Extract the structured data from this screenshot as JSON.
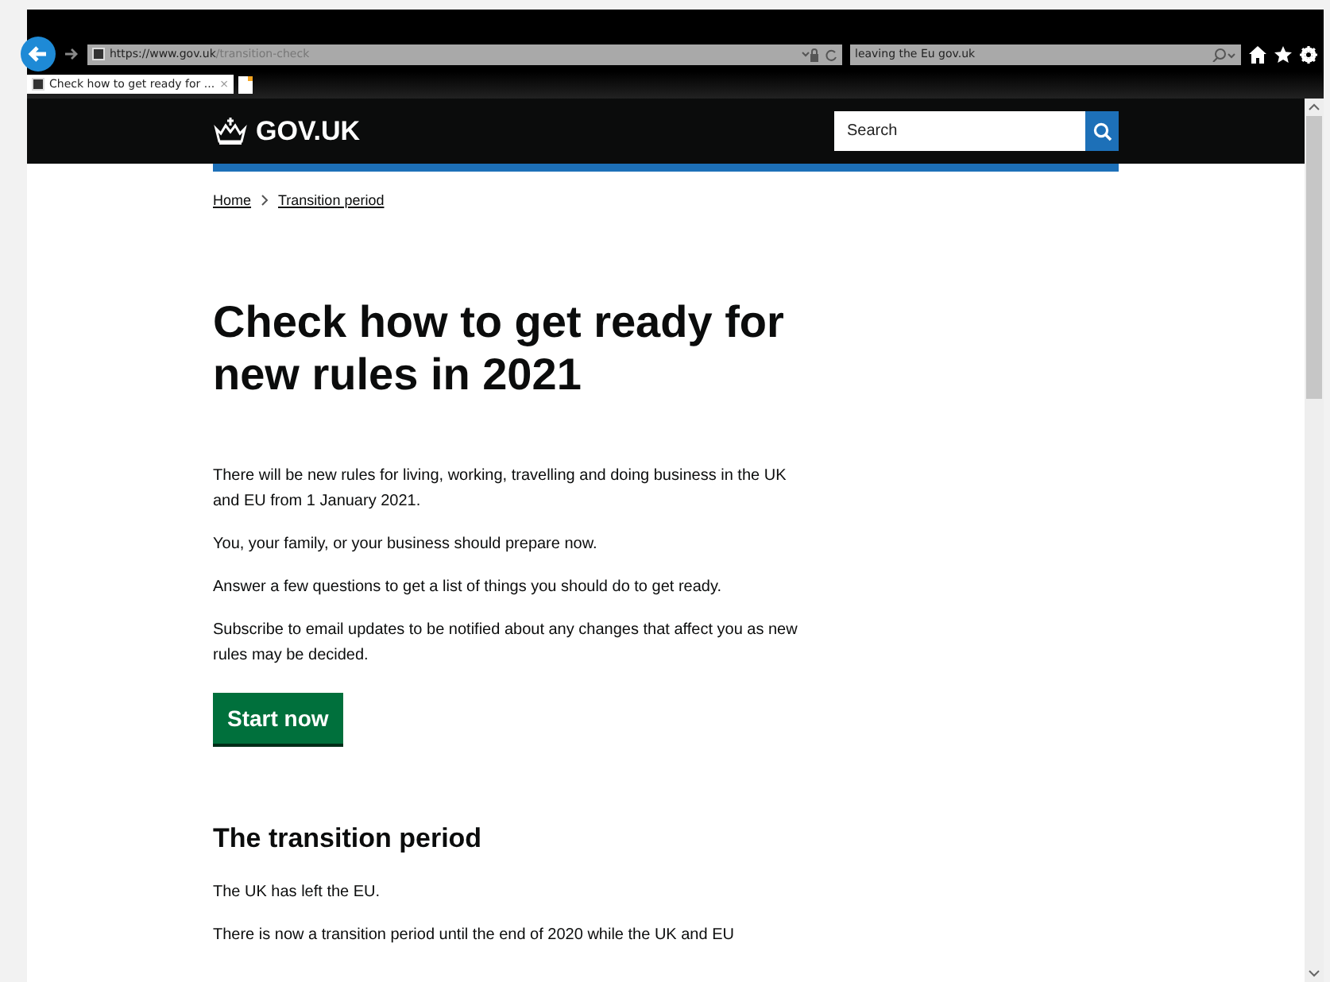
{
  "browser": {
    "url_host": "https://www.gov.uk",
    "url_path": "/transition-check",
    "search_value": "leaving the Eu gov.uk",
    "tab": {
      "title": "Check how to get ready for ...",
      "close": "×",
      "selected": true
    }
  },
  "header": {
    "logo": "GOV.UK",
    "search": {
      "placeholder": "Search"
    }
  },
  "breadcrumbs": [
    "Home",
    "Transition period"
  ],
  "title": "Check how to get ready for new rules in 2021",
  "paragraphs": [
    "There will be new rules for living, working, travelling and doing business in the UK and EU from 1 January 2021.",
    "You, your family, or your business should prepare now.",
    "Answer a few questions to get a list of things you should do to get ready.",
    "Subscribe to email updates to be notified about any changes that affect you as new rules may be decided."
  ],
  "start_button": "Start now",
  "section": {
    "heading": "The transition period",
    "paragraphs": [
      "The UK has left the EU.",
      "There is now a transition period until the end of 2020 while the UK and EU"
    ]
  }
}
